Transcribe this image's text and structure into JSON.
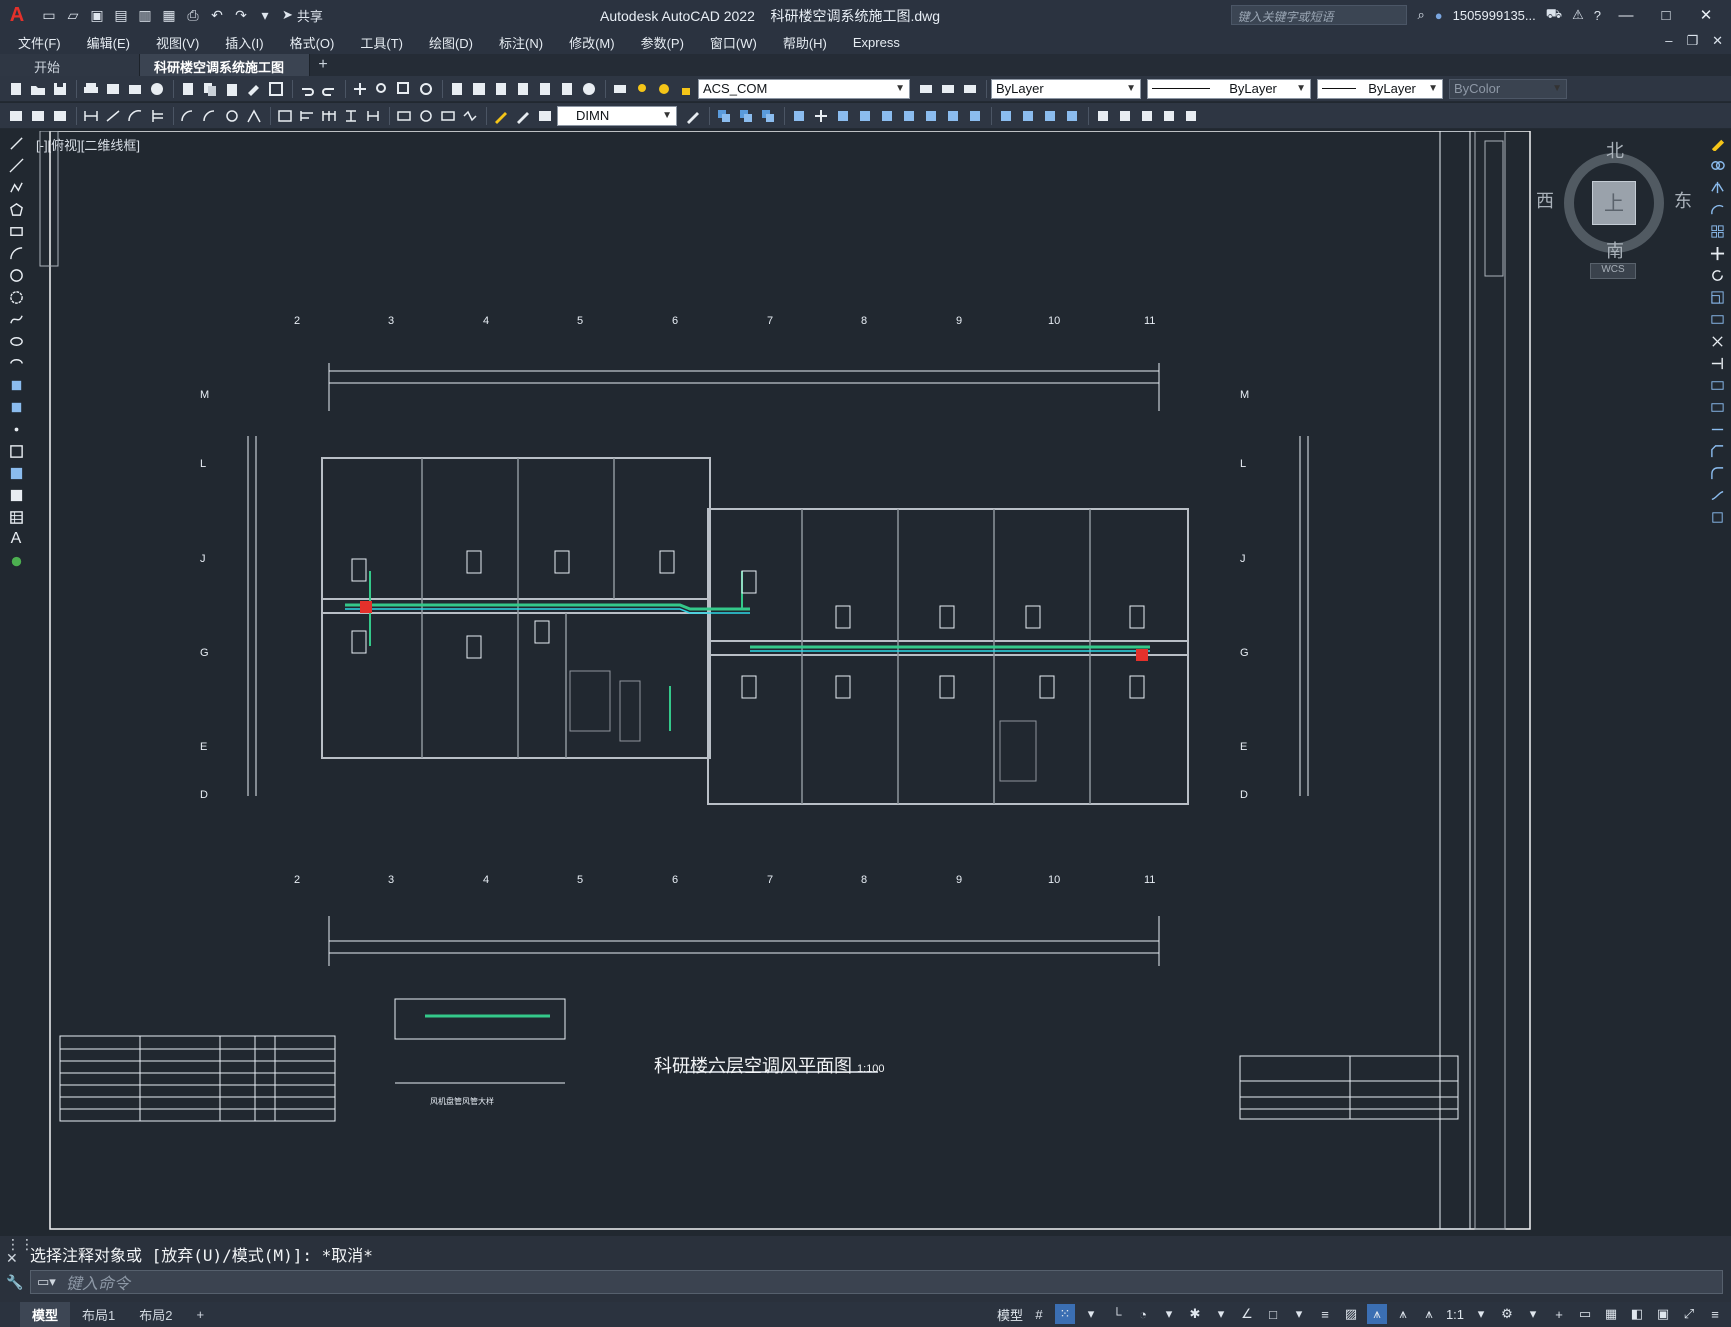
{
  "app": {
    "title": "Autodesk AutoCAD 2022",
    "file": "科研楼空调系统施工图.dwg"
  },
  "titlebar": {
    "share_label": "共享",
    "search_placeholder": "键入关键字或短语",
    "user": "1505999135..."
  },
  "menu": [
    "文件(F)",
    "编辑(E)",
    "视图(V)",
    "插入(I)",
    "格式(O)",
    "工具(T)",
    "绘图(D)",
    "标注(N)",
    "修改(M)",
    "参数(P)",
    "窗口(W)",
    "帮助(H)",
    "Express"
  ],
  "tabs": {
    "start": "开始",
    "active": "科研楼空调系统施工图*"
  },
  "toolbar": {
    "layer": "ACS_COM",
    "color": "ByLayer",
    "linetype": "ByLayer",
    "lineweight": "ByLayer",
    "plotstyle": "ByColor",
    "dimstyle": "DIMN"
  },
  "viewport": {
    "label": "[-][俯视][二维线框]"
  },
  "viewcube": {
    "north": "北",
    "south": "南",
    "east": "东",
    "west": "西",
    "top": "上",
    "wcs": "WCS"
  },
  "drawing": {
    "title": "科研楼六层空调风平面图",
    "scale": "1:100",
    "detail_title": "风机盘管风管大样",
    "axis_cols": [
      "2",
      "3",
      "4",
      "5",
      "6",
      "7",
      "8",
      "9",
      "10",
      "11"
    ],
    "axis_rows": [
      "M",
      "L",
      "J",
      "G",
      "E",
      "D"
    ]
  },
  "command": {
    "history": "选择注释对象或 [放弃(U)/模式(M)]: *取消*",
    "placeholder": "键入命令"
  },
  "status": {
    "model_tabs": [
      "模型",
      "布局1",
      "布局2"
    ],
    "model_label": "模型",
    "scale": "1:1"
  }
}
